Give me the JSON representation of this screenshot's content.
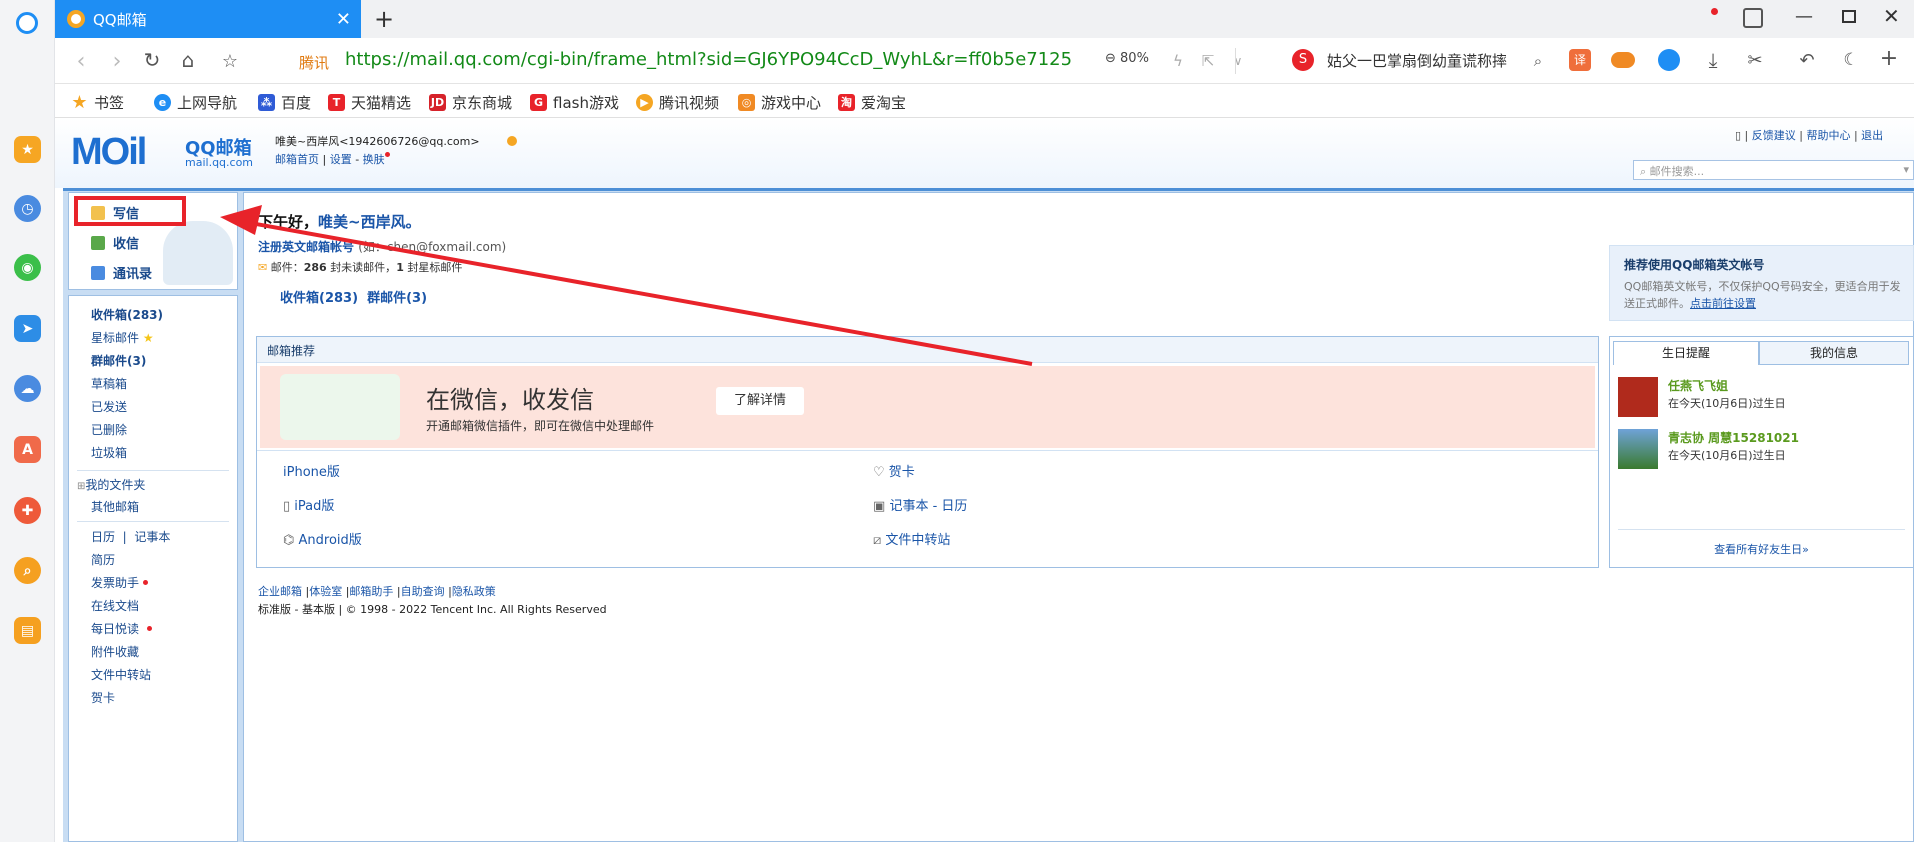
{
  "browser": {
    "tab_title": "QQ邮箱",
    "url_badge": "腾讯",
    "url": "https://mail.qq.com/cgi-bin/frame_html?sid=GJ6YPO94CcD_WyhL&r=ff0b5e7125",
    "zoom": "80%",
    "search_text": "姑父一巴掌扇倒幼童谎称摔",
    "bookmarks": [
      "书签",
      "上网导航",
      "百度",
      "天猫精选",
      "京东商城",
      "flash游戏",
      "腾讯视频",
      "游戏中心",
      "爱淘宝"
    ]
  },
  "mail": {
    "logo_text": "QQ邮箱",
    "logo_sub": "mail.qq.com",
    "user_display": "唯美~西岸风<1942606726@qq.com>",
    "user_links": [
      "邮箱首页",
      "设置",
      "换肤"
    ],
    "top_links": [
      "反馈建议",
      "帮助中心",
      "退出"
    ],
    "search_placeholder": "邮件搜索...",
    "actions": {
      "compose": "写信",
      "inbox": "收信",
      "contacts": "通讯录"
    },
    "folders": {
      "inbox": "收件箱(283)",
      "starred": "星标邮件",
      "group": "群邮件(3)",
      "drafts": "草稿箱",
      "sent": "已发送",
      "deleted": "已删除",
      "trash": "垃圾箱",
      "my_folders": "我的文件夹",
      "other": "其他邮箱",
      "calendar": "日历",
      "notebook": "记事本",
      "resume": "简历",
      "invoice": "发票助手",
      "docs": "在线文档",
      "daily": "每日悦读",
      "attach": "附件收藏",
      "transfer": "文件中转站",
      "card": "贺卡"
    },
    "greeting_prefix": "下午好，",
    "greeting_name": "唯美~西岸风。",
    "register_text": "注册英文邮箱帐号",
    "register_hint": "(如：chen@foxmail.com)",
    "mail_stats_prefix": "邮件：",
    "mail_count": "286",
    "mail_stats_mid": "封未读邮件，",
    "group_count": "1",
    "mail_stats_suffix": "封星标邮件",
    "inbox_link": "收件箱(283)",
    "group_link": "群邮件(3)",
    "promo": {
      "title": "推荐使用QQ邮箱英文帐号",
      "body": "QQ邮箱英文帐号，不仅保护QQ号码安全，更适合用于发送正式邮件。",
      "link": "点击前往设置"
    },
    "recommend": {
      "header": "邮箱推荐",
      "banner_title": "在微信，收发信",
      "banner_sub": "开通邮箱微信插件，即可在微信中处理邮件",
      "banner_btn": "了解详情",
      "apps_left": [
        "iPhone版",
        "iPad版",
        "Android版"
      ],
      "apps_right": [
        "贺卡",
        "记事本 - 日历",
        "文件中转站"
      ]
    },
    "birthday": {
      "tab1": "生日提醒",
      "tab2": "我的信息",
      "people": [
        {
          "name": "任燕飞飞姐",
          "note": "在今天(10月6日)过生日"
        },
        {
          "name": "青志协 周慧15281021",
          "note": "在今天(10月6日)过生日"
        }
      ],
      "more": "查看所有好友生日»"
    },
    "footer_links": [
      "企业邮箱",
      "体验室",
      "邮箱助手",
      "自助查询",
      "隐私政策"
    ],
    "footer_copy": "标准版 - 基本版 | © 1998 - 2022 Tencent Inc. All Rights Reserved"
  },
  "colors": {
    "accent": "#1e8ef4",
    "annotation": "#e8232a",
    "link": "#1a55a8"
  }
}
